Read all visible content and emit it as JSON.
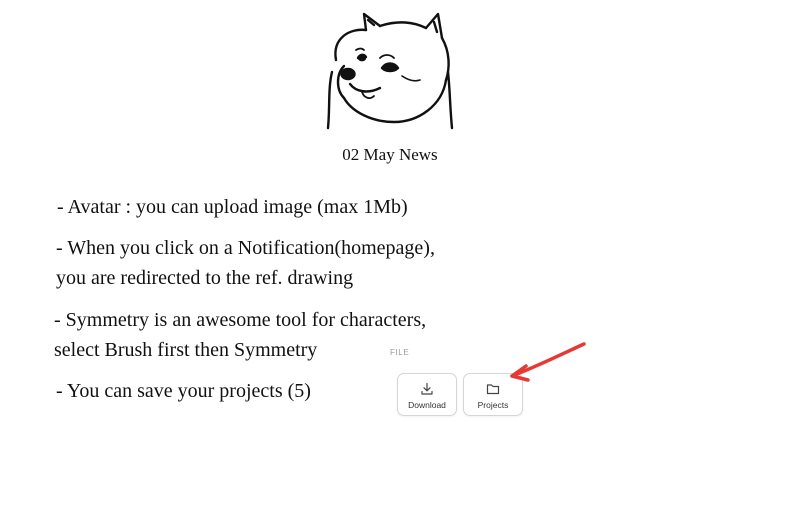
{
  "page": {
    "title": "02 May News"
  },
  "notes": [
    {
      "lines": [
        "- Avatar : you can upload image (max 1Mb)"
      ]
    },
    {
      "lines": [
        "- When you click on a Notification(homepage),",
        "you are redirected to the ref. drawing"
      ]
    },
    {
      "lines": [
        "- Symmetry is an awesome tool for characters,",
        "select Brush first then Symmetry"
      ]
    },
    {
      "lines": [
        "- You can save your projects (5)"
      ]
    }
  ],
  "file_panel": {
    "label": "FILE",
    "buttons": [
      {
        "label": "Download",
        "icon": "download-icon"
      },
      {
        "label": "Projects",
        "icon": "folder-icon"
      }
    ]
  },
  "annotation": {
    "arrow_color": "#e53935"
  },
  "logo": {
    "icon": "doge-avatar"
  }
}
